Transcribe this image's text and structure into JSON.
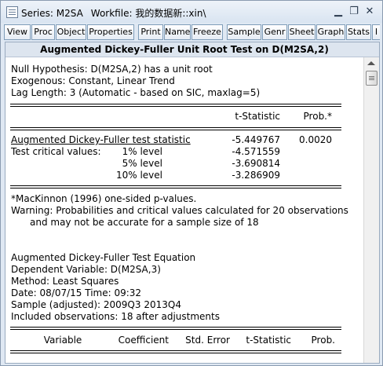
{
  "window": {
    "series_title": "Series: M2SA",
    "workfile_title": "Workfile: 我的数据新::xin\\",
    "controls": {
      "minimize": "▁",
      "restore": "❐",
      "close": "✕"
    }
  },
  "toolbar": {
    "buttons": [
      "View",
      "Proc",
      "Object",
      "Properties",
      "Print",
      "Name",
      "Freeze",
      "Sample",
      "Genr",
      "Sheet",
      "Graph",
      "Stats",
      "I"
    ]
  },
  "output": {
    "header_title": "Augmented Dickey-Fuller Unit Root Test on D(M2SA,2)",
    "null_hypothesis": "Null Hypothesis: D(M2SA,2) has a unit root",
    "exogenous": "Exogenous: Constant, Linear Trend",
    "lag_length": "Lag Length: 3 (Automatic - based on SIC, maxlag=5)",
    "col_tstat": "t-Statistic",
    "col_prob": "Prob.*",
    "adf_label": "Augmented Dickey-Fuller test statistic",
    "adf_tstat": "-5.449767",
    "adf_prob": "0.0020",
    "critical_label": "Test critical values:",
    "critical": [
      {
        "level": "1% level",
        "value": "-4.571559"
      },
      {
        "level": "5% level",
        "value": "-3.690814"
      },
      {
        "level": "10% level",
        "value": "-3.286909"
      }
    ],
    "note_mackinnon": "*MacKinnon (1996) one-sided p-values.",
    "warning_line1": "Warning: Probabilities and critical values calculated for 20 observations",
    "warning_line2": "and may not be accurate for a sample size of 18",
    "eq_title": "Augmented Dickey-Fuller Test Equation",
    "dep_var": "Dependent Variable: D(M2SA,3)",
    "method": "Method: Least Squares",
    "date_time": "Date: 08/07/15   Time: 09:32",
    "sample": "Sample (adjusted): 2009Q3 2013Q4",
    "included_obs": "Included observations: 18 after adjustments",
    "table_headers": [
      "Variable",
      "Coefficient",
      "Std. Error",
      "t-Statistic",
      "Prob."
    ]
  }
}
